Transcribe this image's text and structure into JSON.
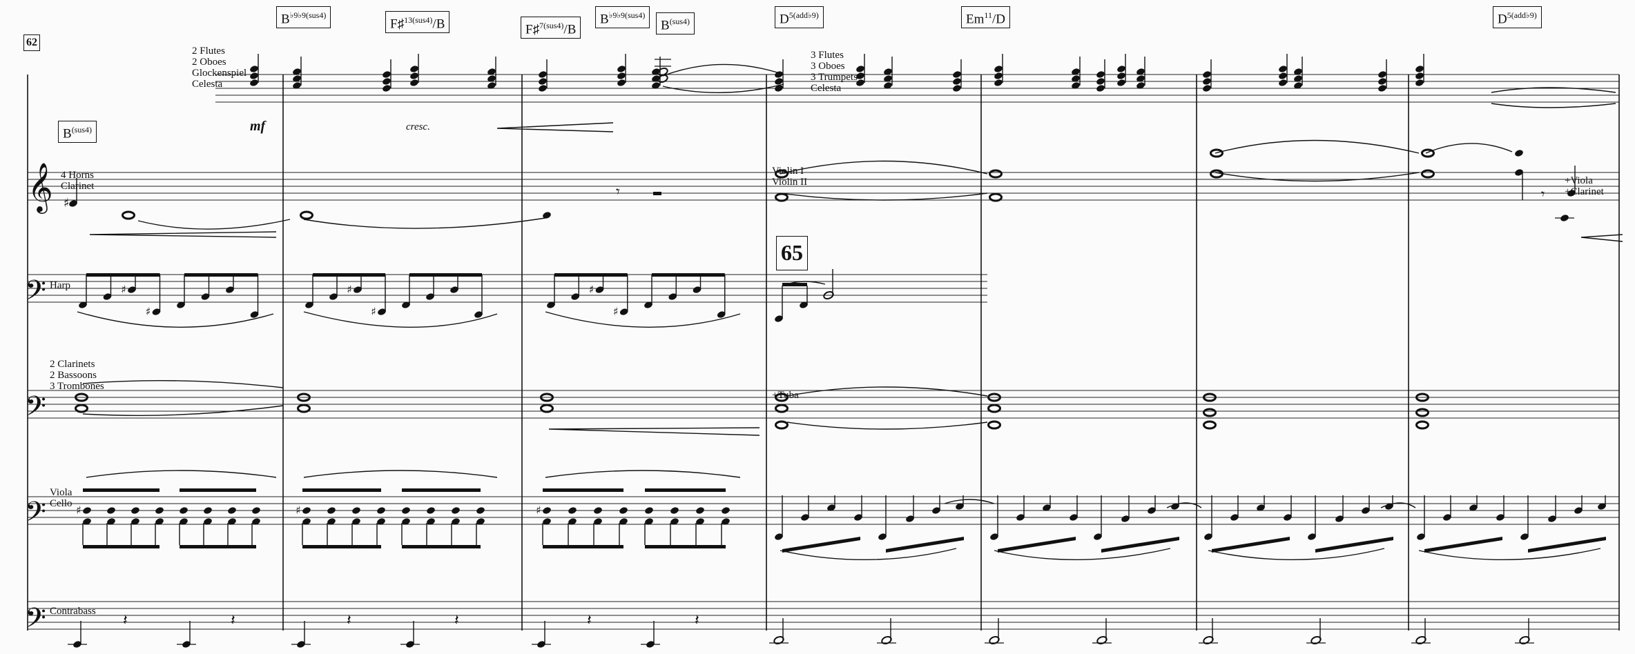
{
  "measure_number": "62",
  "rehearsal_mark": "65",
  "chords": [
    {
      "root": "B",
      "ext": "♭9♭9(sus4)",
      "sup": false
    },
    {
      "root": "F♯",
      "ext": "13(sus4)",
      "suffix": "/B",
      "sup": true
    },
    {
      "root": "F♯",
      "ext": "7(sus4)",
      "suffix": "/B",
      "sup": true
    },
    {
      "root": "B",
      "ext": "♭9♭9(sus4)",
      "sup": false
    },
    {
      "root": "B",
      "ext": "(sus4)",
      "sup": true
    },
    {
      "root": "D",
      "ext": "5(add♭9)",
      "sup": true
    },
    {
      "root": "Em",
      "ext": "11",
      "suffix": "/D",
      "sup": true
    },
    {
      "root": "D",
      "ext": "5(add♭9)",
      "sup": true
    },
    {
      "root": "B",
      "ext": "(sus4)",
      "sup": true
    }
  ],
  "instrument_labels": {
    "winds_top": [
      "2 Flutes",
      "2 Oboes",
      "Glockenspiel",
      "Celesta"
    ],
    "winds_65": [
      "3 Flutes",
      "3 Oboes",
      "3 Trumpets",
      "Celesta"
    ],
    "horns": [
      "4 Horns",
      "Clarinet"
    ],
    "violins": [
      "Violin I",
      "Violin II"
    ],
    "viola_add": [
      "+Viola",
      "+Clarinet"
    ],
    "harp": [
      "Harp"
    ],
    "low_winds": [
      "2 Clarinets",
      "2 Bassoons",
      "3 Trombones"
    ],
    "tuba": [
      "+Tuba"
    ],
    "viola_cello": [
      "Viola",
      "Cello"
    ],
    "contrabass": [
      "Contrabass"
    ]
  },
  "dynamics": {
    "mf": "mf",
    "cresc": "cresc."
  },
  "clefs": {
    "treble": "𝄞",
    "bass": "𝄢"
  }
}
